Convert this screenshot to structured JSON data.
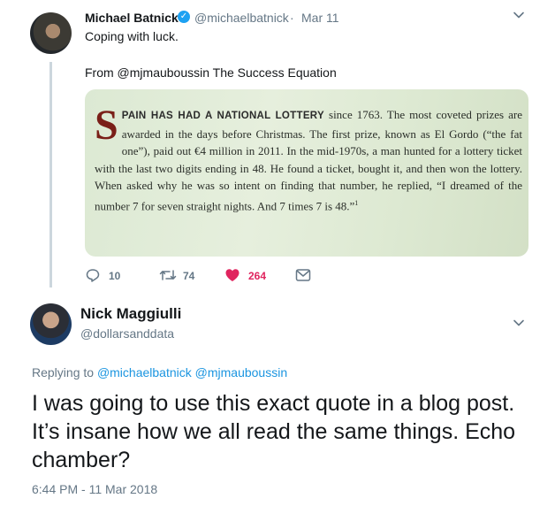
{
  "tweet1": {
    "name": "Michael Batnick",
    "handle": "@michaelbatnick",
    "separator": "·",
    "date": "Mar 11",
    "text": "Coping with luck.",
    "source_line": "From @mjmauboussin The Success Equation",
    "excerpt": {
      "drop_cap": "S",
      "lead": "PAIN HAS HAD A NATIONAL LOTTERY",
      "body": " since 1763. The most coveted prizes are awarded in the days before Christmas. The first prize, known as El Gordo (“the fat one”), paid out €4 million in 2011. In the mid-1970s, a man hunted for a lottery ticket with the last two digits ending in 48. He found a ticket, bought it, and then won the lottery. When asked why he was so intent on finding that number, he replied, “I dreamed of the number 7 for seven straight nights. And 7 times 7 is 48.”",
      "footnote": "1"
    },
    "actions": {
      "replies": "10",
      "retweets": "74",
      "likes": "264"
    }
  },
  "tweet2": {
    "name": "Nick Maggiulli",
    "handle": "@dollarsanddata",
    "replying_prefix": "Replying to",
    "replying_to": "@michaelbatnick @mjmauboussin",
    "text": "I was going to use this exact quote in a blog post.  It’s insane how we all read the same things. Echo chamber?",
    "timestamp": "6:44 PM - 11 Mar 2018"
  },
  "colors": {
    "text": "#14171a",
    "muted": "#657786",
    "link": "#1b95e0",
    "like": "#e0245e",
    "verified": "#1da1f2"
  }
}
